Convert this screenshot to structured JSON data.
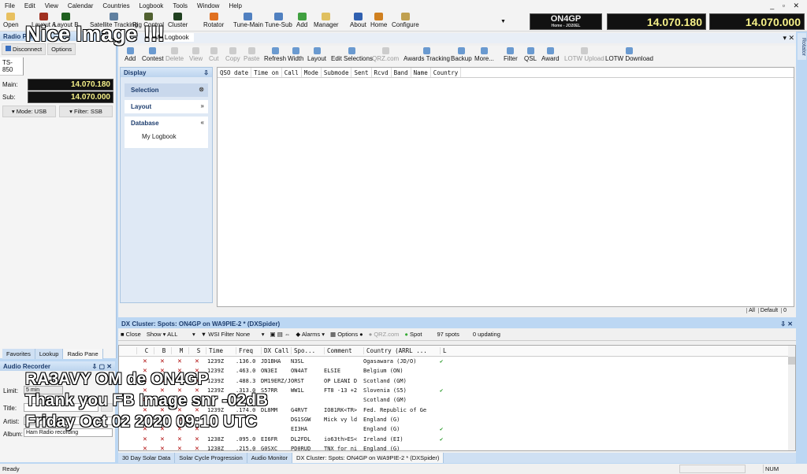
{
  "menu": [
    "File",
    "Edit",
    "View",
    "Calendar",
    "Countries",
    "Logbook",
    "Tools",
    "Window",
    "Help"
  ],
  "toolbar": [
    {
      "label": "Open",
      "color": "#e8c060"
    },
    {
      "label": "Layout A",
      "color": "#a03020"
    },
    {
      "label": "Layout B",
      "color": "#206020"
    },
    {
      "label": "Satellite Tracking",
      "color": "#6080a0"
    },
    {
      "label": "Rig Control",
      "color": "#506030"
    },
    {
      "label": "Cluster",
      "color": "#204020"
    },
    {
      "label": "Rotator",
      "color": "#e07020"
    },
    {
      "label": "Tune-Main",
      "color": "#5080c0"
    },
    {
      "label": "Tune-Sub",
      "color": "#5080c0"
    },
    {
      "label": "Add",
      "color": "#40a040"
    },
    {
      "label": "Manager",
      "color": "#e0c060"
    },
    {
      "label": "About",
      "color": "#3060b0"
    },
    {
      "label": "Home",
      "color": "#d08020"
    },
    {
      "label": "Configure",
      "color": "#c0a050"
    }
  ],
  "station": {
    "callsign": "ON4GP",
    "location": "Home - JO20EL",
    "main_freq": "14.070.180",
    "sub_freq": "14.070.000"
  },
  "radio": {
    "title": "Radio Pane",
    "disconnect": "Disconnect",
    "options": "Options",
    "rig_tab": "TS-850",
    "main_label": "Main:",
    "main_freq": "14.070.180",
    "sub_label": "Sub:",
    "sub_freq": "14.070.000",
    "mode": "Mode: USB",
    "filter": "Filter: SSB"
  },
  "left_tabs": [
    "Favorites",
    "Lookup",
    "Radio Pane"
  ],
  "audio": {
    "title": "Audio Recorder",
    "limit_label": "Limit:",
    "limit_value": "5 min",
    "title_label": "Title:",
    "artist_label": "Artist:",
    "album_label": "Album:",
    "album_value": "Ham Radio recording"
  },
  "logbook": {
    "tab_title": "My Logbook",
    "tools": [
      {
        "label": "Add",
        "on": true
      },
      {
        "label": "Contest",
        "on": true
      },
      {
        "label": "Delete",
        "on": false
      },
      {
        "label": "View",
        "on": false
      },
      {
        "label": "Cut",
        "on": false
      },
      {
        "label": "Copy",
        "on": false
      },
      {
        "label": "Paste",
        "on": false
      },
      {
        "label": "Refresh",
        "on": true
      },
      {
        "label": "Width",
        "on": true
      },
      {
        "label": "Layout",
        "on": true
      },
      {
        "label": "Edit Selections",
        "on": true
      },
      {
        "label": "QRZ.com",
        "on": false
      },
      {
        "label": "Awards Tracking",
        "on": true
      },
      {
        "label": "Backup",
        "on": true
      },
      {
        "label": "More...",
        "on": true
      },
      {
        "label": "Filter",
        "on": true
      },
      {
        "label": "QSL",
        "on": true
      },
      {
        "label": "Award",
        "on": true
      },
      {
        "label": "LOTW Upload",
        "on": false
      },
      {
        "label": "LOTW Download",
        "on": true
      }
    ],
    "display_title": "Display",
    "groups": [
      "Selection",
      "Layout",
      "Database"
    ],
    "database_item": "My Logbook",
    "columns": [
      "QSO date",
      "Time on",
      "Call",
      "Mode",
      "Submode",
      "Sent",
      "Rcvd",
      "Band",
      "Name",
      "Country"
    ],
    "footer": [
      "All",
      "Default",
      "0"
    ]
  },
  "rotator_tab": "Rotator",
  "dx": {
    "title": "DX Cluster: Spots: ON4GP on WA9PIE-2 * (DXSpider)",
    "close": "Close",
    "show": "Show",
    "show_value": "ALL",
    "wsi": "WSI Filter",
    "wsi_value": "None",
    "alarms": "Alarms",
    "options": "Options",
    "qrz": "QRZ.com",
    "spot": "Spot",
    "spots": "97 spots",
    "updating": "0 updating",
    "columns": [
      "C",
      "B",
      "M",
      "S",
      "Time",
      "Freq",
      "DX Call",
      "Spo...",
      "Comment",
      "Country (ARRL ...",
      "L"
    ],
    "rows": [
      {
        "time": "1239Z",
        "freq": ".136.0",
        "call": "JD1BHA",
        "spotter": "N3SL",
        "comment": "",
        "country": "Ogasawara (JD/O)",
        "lotw": "✔"
      },
      {
        "time": "1239Z",
        "freq": ".463.0",
        "call": "ON3EI",
        "spotter": "ON4AT",
        "comment": "ELSIE",
        "country": "Belgium (ON)",
        "lotw": ""
      },
      {
        "time": "1239Z",
        "freq": ".488.3",
        "call": "DM19ERZ/J",
        "spotter": "ORST",
        "comment": "OP LEANI D",
        "country": "Scotland (GM)",
        "lotw": ""
      },
      {
        "time": "1239Z",
        "freq": ".313.0",
        "call": "S57RR",
        "spotter": "WW1L",
        "comment": "FT8 -13 +2",
        "country": "Slovenia (S5)",
        "lotw": "✔"
      },
      {
        "time": "",
        "freq": "",
        "call": "",
        "spotter": "",
        "comment": "",
        "country": "Scotland (GM)",
        "lotw": ""
      },
      {
        "time": "1239Z",
        "freq": ".174.0",
        "call": "DL8MM",
        "spotter": "G4RVT",
        "comment": "IO81RK<TR>",
        "country": "Fed. Republic of Ge",
        "lotw": ""
      },
      {
        "time": "",
        "freq": "",
        "call": "",
        "spotter": "DG1SGW",
        "comment": "Mick vy ld",
        "country": "England (G)",
        "lotw": ""
      },
      {
        "time": "",
        "freq": "",
        "call": "",
        "spotter": "EI3HA",
        "comment": "",
        "country": "England (G)",
        "lotw": "✔"
      },
      {
        "time": "1238Z",
        "freq": ".095.0",
        "call": "EI6FR",
        "spotter": "DL2FDL",
        "comment": "io63th>ES<",
        "country": "Ireland (EI)",
        "lotw": "✔"
      },
      {
        "time": "1238Z",
        "freq": ".215.0",
        "call": "G0SXC",
        "spotter": "PD0RUD",
        "comment": "TNX for ni",
        "country": "England (G)",
        "lotw": ""
      }
    ]
  },
  "bottom_tabs": [
    "30 Day Solar Data",
    "Solar Cycle Progression",
    "Audio Monitor",
    "DX Cluster: Spots: ON4GP on WA9PIE-2 * (DXSpider)"
  ],
  "status": {
    "ready": "Ready",
    "num": "NUM"
  },
  "overlay": {
    "line1": "Nice Image !!!",
    "line2": "RA3AVY OM de ON4GP",
    "line3": "Thank you FB Image snr -02dB",
    "line4": "Friday Oct 02 2020 09:10 UTC"
  }
}
